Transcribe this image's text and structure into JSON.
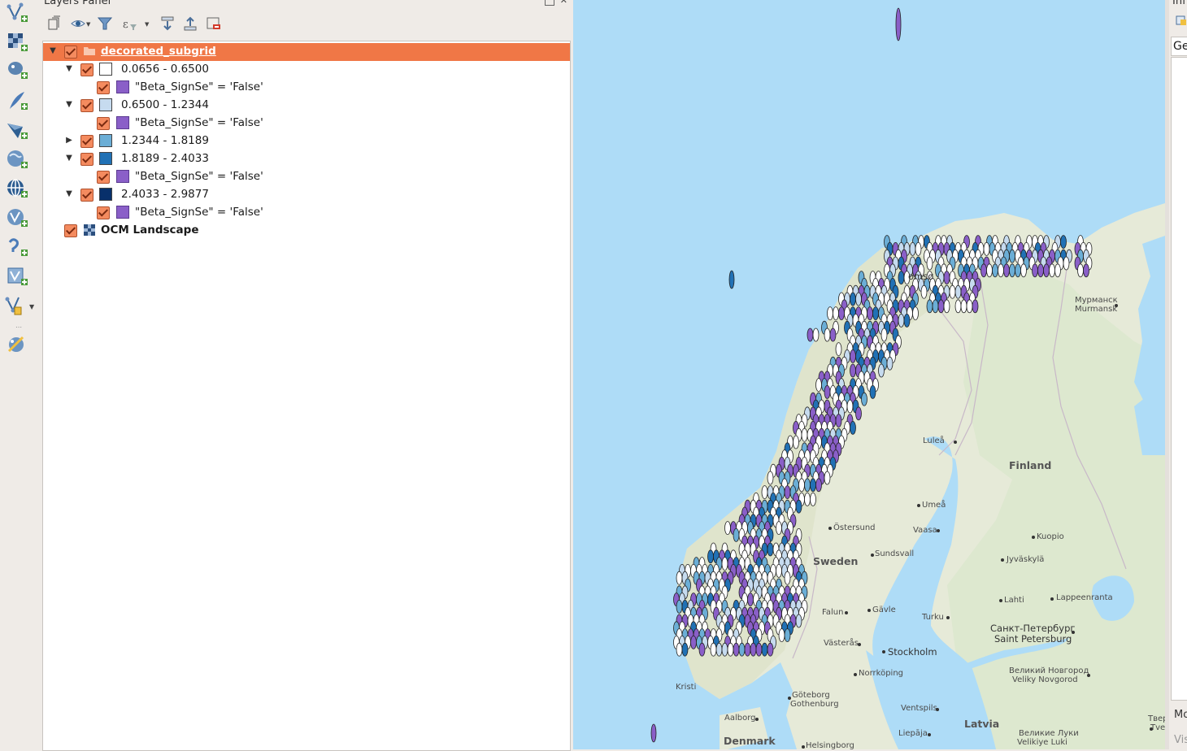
{
  "panel": {
    "title": "Layers Panel"
  },
  "layers": {
    "group": {
      "name": "decorated_subgrid"
    },
    "classes": [
      {
        "range": "0.0656 - 0.6500",
        "color": "#ffffff",
        "expanded": true,
        "rule": "\"Beta_SignSe\" = 'False'"
      },
      {
        "range": "0.6500 - 1.2344",
        "color": "#c6dbef",
        "expanded": true,
        "rule": "\"Beta_SignSe\" = 'False'"
      },
      {
        "range": "1.2344 - 1.8189",
        "color": "#6baed6",
        "expanded": false,
        "rule": ""
      },
      {
        "range": "1.8189 - 2.4033",
        "color": "#2171b5",
        "expanded": true,
        "rule": "\"Beta_SignSe\" = 'False'"
      },
      {
        "range": "2.4033 - 2.9877",
        "color": "#08306b",
        "expanded": true,
        "rule": "\"Beta_SignSe\" = 'False'"
      }
    ],
    "rule_color": "#8a5fc8",
    "basemap": {
      "name": "OCM Landscape"
    }
  },
  "map": {
    "labels": {
      "tromso": "omsø",
      "murmansk_ru": "Мурманск",
      "murmansk": "Murmansk",
      "lulea": "Luleå",
      "finland": "Finland",
      "umea": "Umeå",
      "ostersund": "Östersund",
      "vaasa": "Vaasa",
      "kuopio": "Kuopio",
      "sweden": "Sweden",
      "sundsvall": "Sundsvall",
      "jyvaskyla": "Jyväskylä",
      "falun": "Falun",
      "gavle": "Gävle",
      "turku": "Turku",
      "lahti": "Lahti",
      "lappeenranta": "Lappeenranta",
      "spb_ru": "Санкт-Петербург",
      "spb": "Saint Petersburg",
      "vasteras": "Västerås",
      "stockholm": "Stockholm",
      "norrkoping": "Norrköping",
      "novgorod_ru": "Великий Новгород",
      "novgorod": "Veliky Novgorod",
      "kristiansand": "Kristi",
      "goteborg": "Göteborg",
      "gothenburg": "Gothenburg",
      "ventspils": "Ventspils",
      "aalborg": "Aalborg",
      "latvia": "Latvia",
      "tver_ru": "Твeр",
      "tver": "Tver",
      "velikiye_ru": "Великие Луки",
      "velikiye": "Velikiye Luki",
      "liepaja": "Liepāja",
      "denmark": "Denmark",
      "helsingborg": "Helsingborg"
    }
  },
  "right_panel": {
    "title": "Inf",
    "tab": "Ge",
    "bottom": "Mo",
    "bottom2": "Vis"
  }
}
